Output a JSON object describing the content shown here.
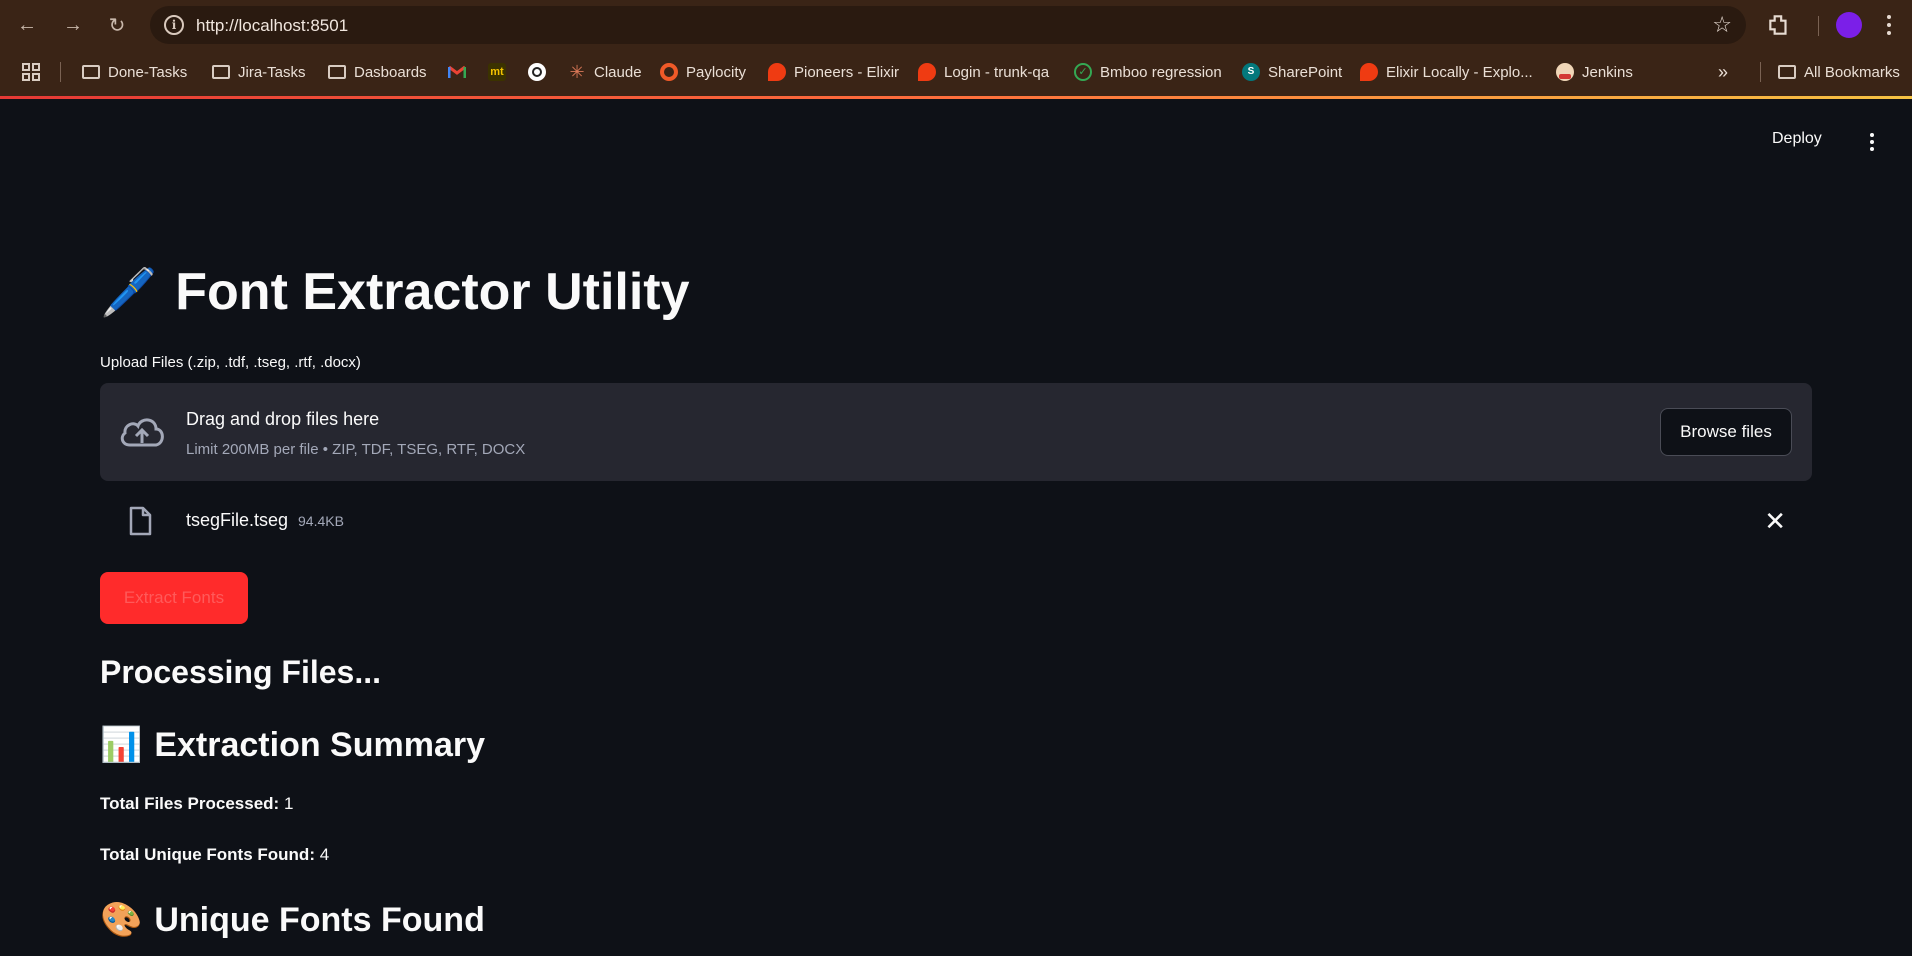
{
  "browser": {
    "url": "http://localhost:8501",
    "bookmarks": [
      {
        "label": "Done-Tasks",
        "icon": "folder-icon"
      },
      {
        "label": "Jira-Tasks",
        "icon": "folder-icon"
      },
      {
        "label": "Dasboards",
        "icon": "folder-icon"
      },
      {
        "label": "",
        "icon": "gmail-icon"
      },
      {
        "label": "",
        "icon": "mt-icon"
      },
      {
        "label": "",
        "icon": "openai-icon"
      },
      {
        "label": "Claude",
        "icon": "claude-icon"
      },
      {
        "label": "Paylocity",
        "icon": "paylocity-icon"
      },
      {
        "label": "Pioneers - Elixir",
        "icon": "elixir-icon"
      },
      {
        "label": "Login - trunk-qa",
        "icon": "elixir-icon"
      },
      {
        "label": "Bmboo regression",
        "icon": "check-circle-icon"
      },
      {
        "label": "SharePoint",
        "icon": "sharepoint-icon"
      },
      {
        "label": "Elixir Locally - Explo...",
        "icon": "elixir-icon"
      },
      {
        "label": "Jenkins",
        "icon": "jenkins-icon"
      }
    ],
    "all_bookmarks": "All Bookmarks",
    "overflow": "»"
  },
  "app": {
    "deploy_label": "Deploy",
    "title": "Font Extractor Utility",
    "title_emoji": "🖊️",
    "upload": {
      "label": "Upload Files (.zip, .tdf, .tseg, .rtf, .docx)",
      "drop_title": "Drag and drop files here",
      "drop_subtitle": "Limit 200MB per file • ZIP, TDF, TSEG, RTF, DOCX",
      "browse_label": "Browse files"
    },
    "file": {
      "name": "tsegFile.tseg",
      "size": "94.4KB"
    },
    "extract_button": "Extract Fonts",
    "processing_heading": "Processing Files...",
    "summary_heading": "Extraction Summary",
    "summary_emoji": "📊",
    "stats": [
      {
        "label": "Total Files Processed:",
        "value": "1"
      },
      {
        "label": "Total Unique Fonts Found:",
        "value": "4"
      }
    ],
    "unique_heading": "Unique Fonts Found",
    "unique_emoji": "🎨"
  },
  "colors": {
    "background": "#0e1117",
    "chrome": "#3a2416",
    "primary": "#ff2b2b",
    "dropzone": "#262730"
  }
}
